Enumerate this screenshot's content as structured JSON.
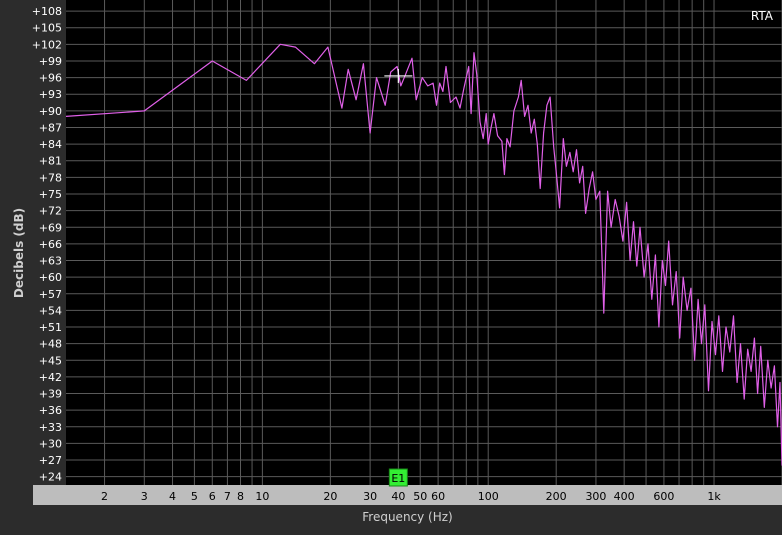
{
  "chart_data": {
    "type": "line",
    "title": "RTA",
    "xlabel": "Frequency (Hz)",
    "ylabel": "Decibels (dB)",
    "x_scale": "log",
    "xlim": [
      1.35,
      2000
    ],
    "ylim": [
      22.5,
      110
    ],
    "grid": true,
    "y_ticks": [
      {
        "value": 108,
        "label": "+108"
      },
      {
        "value": 105,
        "label": "+105"
      },
      {
        "value": 102,
        "label": "+102"
      },
      {
        "value": 99,
        "label": "+99"
      },
      {
        "value": 96,
        "label": "+96"
      },
      {
        "value": 93,
        "label": "+93"
      },
      {
        "value": 90,
        "label": "+90"
      },
      {
        "value": 87,
        "label": "+87"
      },
      {
        "value": 84,
        "label": "+84"
      },
      {
        "value": 81,
        "label": "+81"
      },
      {
        "value": 78,
        "label": "+78"
      },
      {
        "value": 75,
        "label": "+75"
      },
      {
        "value": 72,
        "label": "+72"
      },
      {
        "value": 69,
        "label": "+69"
      },
      {
        "value": 66,
        "label": "+66"
      },
      {
        "value": 63,
        "label": "+63"
      },
      {
        "value": 60,
        "label": "+60"
      },
      {
        "value": 57,
        "label": "+57"
      },
      {
        "value": 54,
        "label": "+54"
      },
      {
        "value": 51,
        "label": "+51"
      },
      {
        "value": 48,
        "label": "+48"
      },
      {
        "value": 45,
        "label": "+45"
      },
      {
        "value": 42,
        "label": "+42"
      },
      {
        "value": 39,
        "label": "+39"
      },
      {
        "value": 36,
        "label": "+36"
      },
      {
        "value": 33,
        "label": "+33"
      },
      {
        "value": 30,
        "label": "+30"
      },
      {
        "value": 27,
        "label": "+27"
      },
      {
        "value": 24,
        "label": "+24"
      }
    ],
    "x_ticks": [
      {
        "value": 2,
        "label": "2"
      },
      {
        "value": 3,
        "label": "3"
      },
      {
        "value": 4,
        "label": "4"
      },
      {
        "value": 5,
        "label": "5"
      },
      {
        "value": 6,
        "label": "6"
      },
      {
        "value": 7,
        "label": "7"
      },
      {
        "value": 8,
        "label": "8"
      },
      {
        "value": 10,
        "label": "10"
      },
      {
        "value": 20,
        "label": "20"
      },
      {
        "value": 30,
        "label": "30"
      },
      {
        "value": 40,
        "label": "40"
      },
      {
        "value": 50,
        "label": "50"
      },
      {
        "value": 60,
        "label": "60"
      },
      {
        "value": 100,
        "label": "100"
      },
      {
        "value": 200,
        "label": "200"
      },
      {
        "value": 300,
        "label": "300"
      },
      {
        "value": 400,
        "label": "400"
      },
      {
        "value": 600,
        "label": "600"
      },
      {
        "value": 1000,
        "label": "1k"
      }
    ],
    "series": [
      {
        "color": "#e060e8",
        "points": [
          [
            1.35,
            89
          ],
          [
            3,
            90
          ],
          [
            6,
            99
          ],
          [
            8.5,
            95.5
          ],
          [
            12,
            102
          ],
          [
            14,
            101.5
          ],
          [
            17,
            98.5
          ],
          [
            19.5,
            101.5
          ],
          [
            22.5,
            90.5
          ],
          [
            24,
            97.5
          ],
          [
            26,
            92
          ],
          [
            28,
            98.5
          ],
          [
            30,
            86
          ],
          [
            32,
            96
          ],
          [
            35,
            91
          ],
          [
            37,
            97
          ],
          [
            39.5,
            98
          ],
          [
            41,
            94.5
          ],
          [
            43,
            96.5
          ],
          [
            46,
            99.5
          ],
          [
            48,
            92
          ],
          [
            51,
            96
          ],
          [
            54,
            94.5
          ],
          [
            57,
            95
          ],
          [
            59,
            91
          ],
          [
            61,
            95
          ],
          [
            63,
            93.5
          ],
          [
            65,
            98
          ],
          [
            68,
            91.5
          ],
          [
            72,
            92.5
          ],
          [
            75,
            90.5
          ],
          [
            78,
            94
          ],
          [
            82,
            98
          ],
          [
            84,
            89.5
          ],
          [
            86.5,
            100.5
          ],
          [
            89,
            96.5
          ],
          [
            92,
            88
          ],
          [
            95,
            85
          ],
          [
            98,
            89.5
          ],
          [
            100,
            84
          ],
          [
            103,
            87
          ],
          [
            106,
            89.5
          ],
          [
            110,
            85.5
          ],
          [
            115,
            84.5
          ],
          [
            118,
            78.5
          ],
          [
            121,
            85
          ],
          [
            125,
            83.5
          ],
          [
            130,
            90
          ],
          [
            136,
            92.5
          ],
          [
            140,
            95.5
          ],
          [
            145,
            89
          ],
          [
            150,
            91
          ],
          [
            155,
            86
          ],
          [
            160,
            88.5
          ],
          [
            165,
            84
          ],
          [
            170,
            76
          ],
          [
            176,
            86
          ],
          [
            182,
            91
          ],
          [
            188,
            92.5
          ],
          [
            195,
            83.5
          ],
          [
            200,
            79
          ],
          [
            207,
            72.5
          ],
          [
            215,
            85
          ],
          [
            222,
            80
          ],
          [
            230,
            82.5
          ],
          [
            238,
            79
          ],
          [
            246,
            83
          ],
          [
            254,
            77
          ],
          [
            262,
            80
          ],
          [
            270,
            71.5
          ],
          [
            280,
            76
          ],
          [
            290,
            79
          ],
          [
            300,
            74
          ],
          [
            312,
            75.5
          ],
          [
            325,
            53.5
          ],
          [
            338,
            75.5
          ],
          [
            350,
            69
          ],
          [
            365,
            74
          ],
          [
            380,
            71
          ],
          [
            395,
            66.5
          ],
          [
            410,
            73.5
          ],
          [
            425,
            63
          ],
          [
            440,
            70
          ],
          [
            455,
            62
          ],
          [
            470,
            69
          ],
          [
            490,
            60
          ],
          [
            510,
            66
          ],
          [
            530,
            56
          ],
          [
            550,
            64
          ],
          [
            570,
            51
          ],
          [
            590,
            63
          ],
          [
            610,
            58.5
          ],
          [
            630,
            66.5
          ],
          [
            655,
            55
          ],
          [
            680,
            61
          ],
          [
            705,
            49
          ],
          [
            730,
            60
          ],
          [
            760,
            54
          ],
          [
            790,
            58
          ],
          [
            820,
            45
          ],
          [
            850,
            56
          ],
          [
            880,
            48
          ],
          [
            910,
            55
          ],
          [
            945,
            39.5
          ],
          [
            980,
            52
          ],
          [
            1015,
            46
          ],
          [
            1050,
            53
          ],
          [
            1090,
            43
          ],
          [
            1130,
            51
          ],
          [
            1175,
            46.5
          ],
          [
            1220,
            53
          ],
          [
            1265,
            41
          ],
          [
            1310,
            48
          ],
          [
            1360,
            38
          ],
          [
            1410,
            47
          ],
          [
            1460,
            43
          ],
          [
            1510,
            49
          ],
          [
            1560,
            39
          ],
          [
            1610,
            47.5
          ],
          [
            1670,
            36.5
          ],
          [
            1730,
            45
          ],
          [
            1790,
            40
          ],
          [
            1850,
            44
          ],
          [
            1910,
            33
          ],
          [
            1960,
            41
          ],
          [
            2000,
            26
          ]
        ]
      }
    ],
    "marker": {
      "label": "E1",
      "x": 40
    }
  }
}
